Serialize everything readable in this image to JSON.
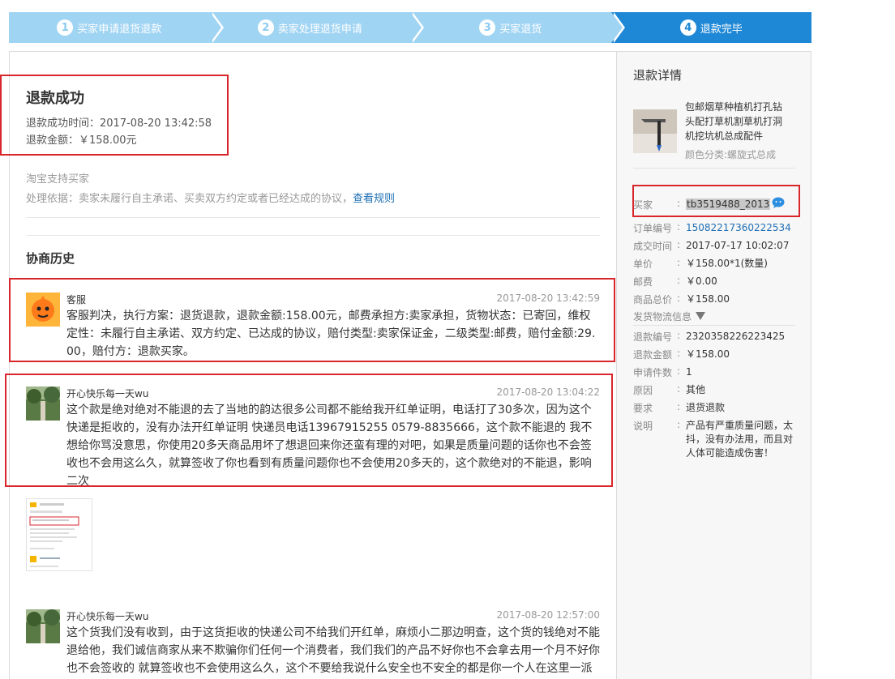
{
  "steps": [
    {
      "num": "1",
      "label": "买家申请退货退款"
    },
    {
      "num": "2",
      "label": "卖家处理退货申请"
    },
    {
      "num": "3",
      "label": "买家退货"
    },
    {
      "num": "4",
      "label": "退款完毕"
    }
  ],
  "status": {
    "title": "退款成功",
    "time_line": "退款成功时间：2017-08-20 13:42:58",
    "amount_line": "退款金额：￥158.00元"
  },
  "support": "淘宝支持买家",
  "basis": {
    "text": "处理依据：卖家未履行自主承诺、买卖双方约定或者已经达成的协议，",
    "link": "查看规则"
  },
  "history_title": "协商历史",
  "messages": [
    {
      "name": "客服",
      "time": "2017-08-20 13:42:59",
      "body": "客服判决，执行方案：退货退款，退款金额:158.00元，邮费承担方:卖家承担，货物状态：已寄回，维权定性：未履行自主承诺、双方约定、已达成的协议，赔付类型:卖家保证金，二级类型:邮费，赔付金额:29.00，赔付方：退款买家。"
    },
    {
      "name": "开心快乐每一天wu",
      "time": "2017-08-20 13:04:22",
      "body": "这个款是绝对绝对不能退的去了当地的韵达很多公司都不能给我开红单证明，电话打了30多次，因为这个快递是拒收的，没有办法开红单证明 快递员电话13967915255 0579-8835666，这个款不能退的 我不想给你骂没意思，你使用20多天商品用坏了想退回来你还蛮有理的对吧，如果是质量问题的话你也不会签收也不会用这么久，就算签收了你也看到有质量问题你也不会使用20多天的，这个款绝对的不能退，影响二次"
    },
    {
      "name": "开心快乐每一天wu",
      "time": "2017-08-20 12:57:00",
      "body": "这个货我们没有收到，由于这货拒收的快递公司不给我们开红单，麻烦小二那边明查，这个货的钱绝对不能退给他，我们诚信商家从来不欺骗你们任何一个消费者，我们我们的产品不好你也不会拿去用一个月不好你也不会签收的 就算签收也不会使用这么久，这个不要给我说什么安全也不安全的都是你一个人在这里一派胡言，我们已经上了属一个人会是得家家盖盖得证明，所以这个钱绝对不能退你"
    }
  ],
  "side": {
    "title": "退款详情",
    "product_name": "包邮烟草种植机打孔钻头配打草机割草机打洞机挖坑机总成配件",
    "product_attr": "颜色分类:螺旋式总成",
    "buyer_label": "买家",
    "buyer_value": "tb3519488_2013",
    "order_rows": [
      {
        "k": "订单编号",
        "v": "15082217360222534",
        "link": true
      },
      {
        "k": "成交时间",
        "v": "2017-07-17 10:02:07"
      },
      {
        "k": "单价",
        "v": "￥158.00*1(数量)"
      },
      {
        "k": "邮费",
        "v": "￥0.00"
      },
      {
        "k": "商品总价",
        "v": "￥158.00"
      }
    ],
    "logistics": "发货物流信息",
    "refund_rows": [
      {
        "k": "退款编号",
        "v": "2320358226223425"
      },
      {
        "k": "退款金额",
        "v": "￥158.00"
      },
      {
        "k": "申请件数",
        "v": "1"
      },
      {
        "k": "原因",
        "v": "其他"
      },
      {
        "k": "要求",
        "v": "退货退款"
      },
      {
        "k": "说明",
        "v": "产品有严重质量问题，太抖，没有办法用，而且对人体可能造成伤害！"
      }
    ]
  },
  "colors": {
    "accent": "#1f88d6",
    "step_inactive": "#a0d4f3",
    "highlight_box": "#d9262c",
    "link": "#1f6fb5"
  }
}
